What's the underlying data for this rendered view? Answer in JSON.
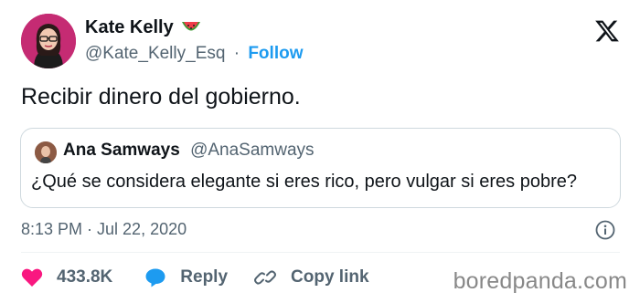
{
  "author": {
    "name": "Kate Kelly",
    "emoji": "watermelon-emoji",
    "handle": "@Kate_Kelly_Esq",
    "separator": "·",
    "follow_label": "Follow"
  },
  "tweet": {
    "text": "Recibir dinero del gobierno."
  },
  "quoted_tweet": {
    "name": "Ana Samways",
    "handle": "@AnaSamways",
    "text": "¿Qué se considera elegante si eres rico, pero vulgar si eres pobre?"
  },
  "meta": {
    "timestamp": "8:13 PM · Jul 22, 2020"
  },
  "actions": {
    "like_count": "433.8K",
    "reply_label": "Reply",
    "copy_label": "Copy link"
  },
  "watermark": "boredpanda.com",
  "colors": {
    "like": "#f91880",
    "reply": "#1d9bf0",
    "follow": "#1d9bf0",
    "secondary_text": "#536471"
  },
  "icons": [
    "x-logo-icon",
    "watermelon-emoji",
    "heart-icon",
    "reply-bubble-icon",
    "link-icon",
    "info-icon"
  ]
}
